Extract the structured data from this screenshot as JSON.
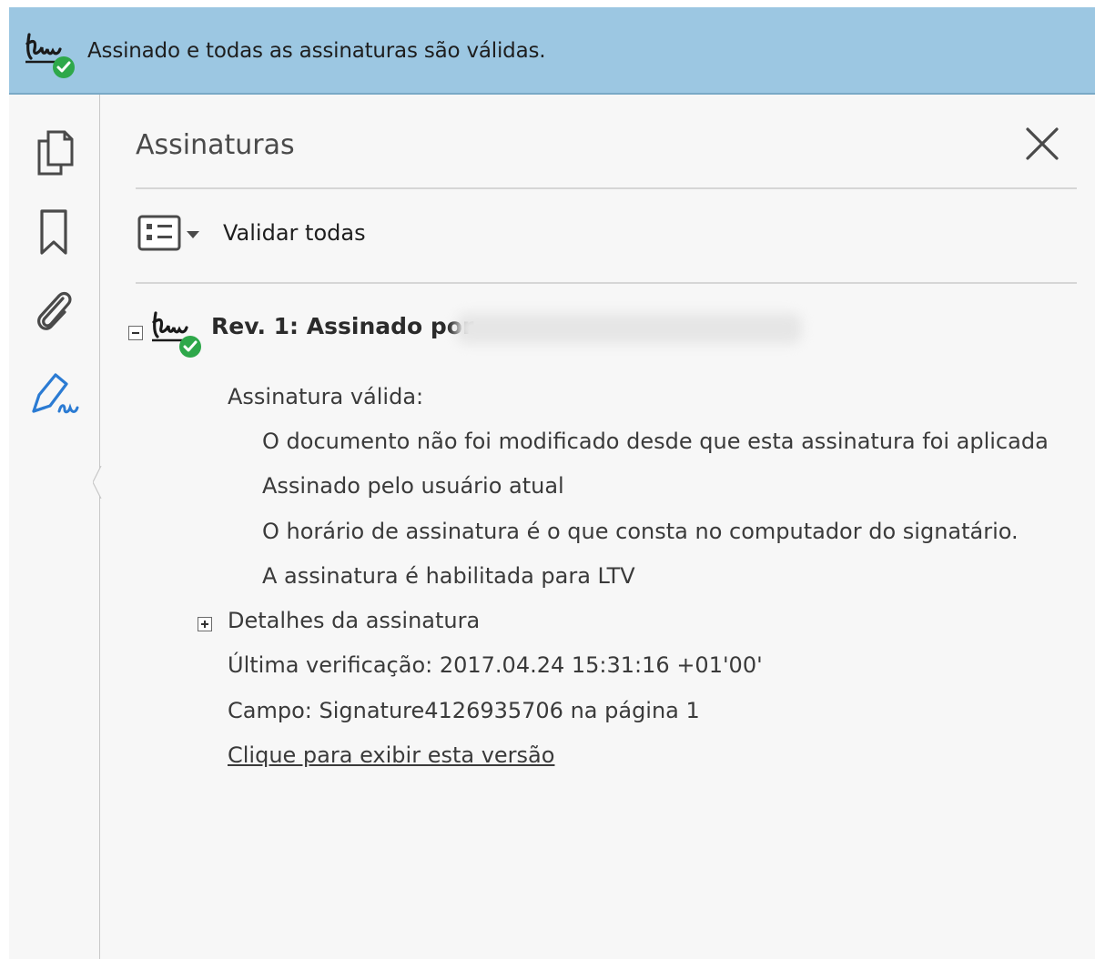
{
  "banner": {
    "icon": "signature-valid-icon",
    "text": "Assinado e todas as assinaturas são válidas.",
    "color": "#9cc7e2"
  },
  "rail": {
    "items": [
      {
        "icon": "pages-icon"
      },
      {
        "icon": "bookmark-icon"
      },
      {
        "icon": "paperclip-icon"
      },
      {
        "icon": "signature-pen-icon",
        "active": true
      }
    ],
    "active_color": "#2b7bd3"
  },
  "panel": {
    "title": "Assinaturas",
    "close_icon": "close-icon",
    "options_icon": "list-options-icon",
    "validate_all": "Validar todas"
  },
  "signature": {
    "rev_label": "Rev. 1: Assinado por",
    "status_heading": "Assinatura válida:",
    "status_lines": [
      "O documento não foi modificado desde que esta assinatura foi aplicada",
      "Assinado pelo usuário atual",
      "O horário de assinatura é o que consta no computador do signatário.",
      "A assinatura é habilitada para LTV"
    ],
    "details_label": "Detalhes da assinatura",
    "last_check": "Última verificação: 2017.04.24 15:31:16 +01'00'",
    "field": "Campo: Signature4126935706 na página 1",
    "view_version_link": "Clique para exibir esta versão"
  },
  "colors": {
    "valid_green": "#2ea84a"
  }
}
